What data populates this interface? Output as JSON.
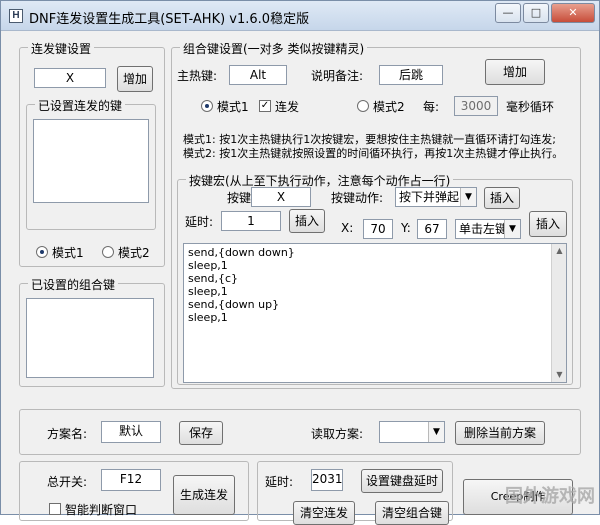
{
  "window": {
    "title": "DNF连发设置生成工具(SET-AHK) v1.6.0稳定版",
    "app_icon": "H",
    "controls": {
      "minimize": "—",
      "maximize": "□",
      "close": "✕"
    }
  },
  "left": {
    "repeat_group_title": "连发键设置",
    "key_value": "X",
    "add_label": "增加",
    "set_keys_title": "已设置连发的键",
    "mode1_label": "模式1",
    "mode2_label": "模式2",
    "combo_set_title": "已设置的组合键"
  },
  "combo": {
    "group_title": "组合键设置(一对多 类似按键精灵)",
    "hotkey_label": "主热键:",
    "hotkey_value": "Alt",
    "note_label": "说明备注:",
    "note_value": "后跳",
    "add_label": "增加",
    "mode1_label": "模式1",
    "repeat_label": "连发",
    "mode2_label": "模式2",
    "every_label": "每:",
    "every_value": "3000",
    "ms_loop_label": "毫秒循环",
    "desc1": "模式1: 按1次主热键执行1次按键宏，要想按住主热键就一直循环请打勾连发;",
    "desc2": "模式2: 按1次主热键就按照设置的时间循环执行，再按1次主热键才停止执行。"
  },
  "macro": {
    "group_title": "按键宏(从上至下执行动作，注意每个动作占一行)",
    "key_label": "按键:",
    "key_value": "X",
    "action_label": "按键动作:",
    "action_value": "按下并弹起",
    "insert_label": "插入",
    "delay_label": "延时:",
    "delay_value": "1",
    "x_label": "X:",
    "x_value": "70",
    "y_label": "Y:",
    "y_value": "67",
    "click_value": "单击左键",
    "script_lines": [
      "send,{down down}",
      "sleep,1",
      "send,{c}",
      "sleep,1",
      "send,{down up}",
      "sleep,1"
    ]
  },
  "scheme": {
    "name_label": "方案名:",
    "name_value": "默认",
    "save_label": "保存",
    "read_label": "读取方案:",
    "delete_label": "删除当前方案"
  },
  "bottom": {
    "master_label": "总开关:",
    "master_value": "F12",
    "smart_window_label": "智能判断窗口",
    "generate_label": "生成连发",
    "delay_label": "延时:",
    "delay_value": "2031",
    "set_delay_label": "设置键盘延时",
    "clear_repeat_label": "清空连发",
    "clear_combo_label": "清空组合键",
    "creep_label": "Creep制作",
    "watermark": "国外游戏网"
  }
}
